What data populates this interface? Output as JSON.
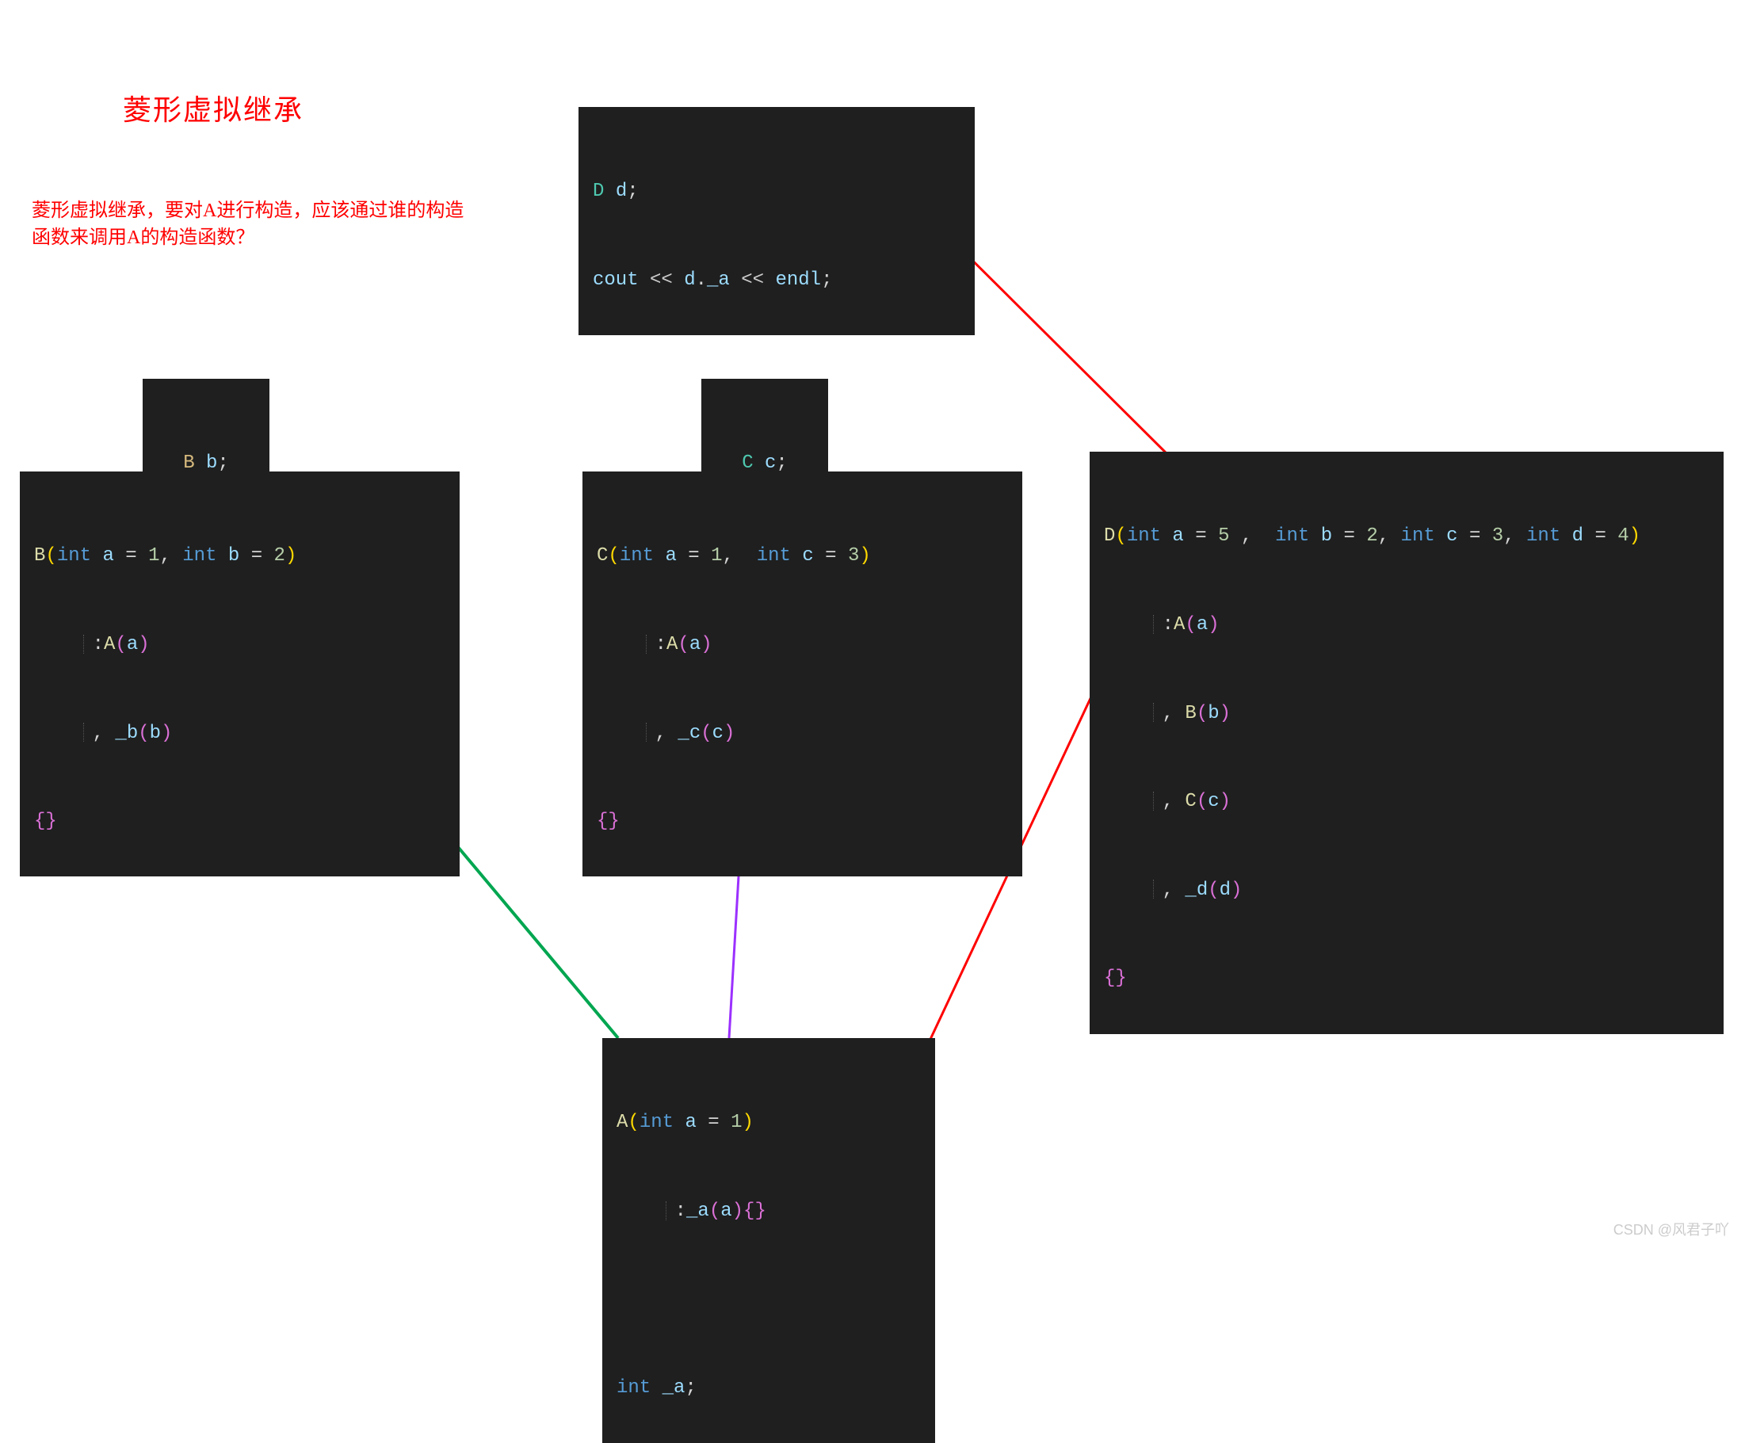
{
  "title": "菱形虚拟继承",
  "subtitle_l1": "菱形虚拟继承，要对A进行构造，应该通过谁的构造",
  "subtitle_l2": "函数来调用A的构造函数？",
  "watermark": "CSDN @风君子吖",
  "box_top": {
    "l1": {
      "D": "D",
      "sp": " ",
      "d": "d",
      "semi": ";"
    },
    "l2": {
      "cout": "cout",
      "op1": " << ",
      "d": "d",
      "dot": ".",
      "a": "_a",
      "op2": " << ",
      "endl": "endl",
      "semi": ";"
    }
  },
  "box_bb": {
    "B": "B ",
    "b": "b",
    "semi": ";"
  },
  "box_cc": {
    "C": "C ",
    "c": "c",
    "semi": ";"
  },
  "box_B": {
    "l1": {
      "B": "B",
      "lp": "(",
      "int1": "int",
      "sp1": " ",
      "a": "a",
      "eq1": " = ",
      "one": "1",
      "comma": ", ",
      "int2": "int",
      "sp2": " ",
      "b": "b",
      "eq2": " = ",
      "two": "2",
      "rp": ")"
    },
    "l2": {
      "colon": ":",
      "A": "A",
      "lp": "(",
      "a": "a",
      "rp": ")"
    },
    "l3": {
      "comma": ", ",
      "_b": "_b",
      "lp": "(",
      "b": "b",
      "rp": ")"
    },
    "l4": {
      "lb": "{",
      "rb": "}"
    }
  },
  "box_C": {
    "l1": {
      "C": "C",
      "lp": "(",
      "int1": "int",
      "sp1": " ",
      "a": "a",
      "eq1": " = ",
      "one": "1",
      "comma": ",  ",
      "int2": "int",
      "sp2": " ",
      "c": "c",
      "eq2": " = ",
      "three": "3",
      "rp": ")"
    },
    "l2": {
      "colon": ":",
      "A": "A",
      "lp": "(",
      "a": "a",
      "rp": ")"
    },
    "l3": {
      "comma": ", ",
      "_c": "_c",
      "lp": "(",
      "c": "c",
      "rp": ")"
    },
    "l4": {
      "lb": "{",
      "rb": "}"
    }
  },
  "box_D": {
    "l1": {
      "D": "D",
      "lp": "(",
      "int1": "int",
      "a": " a",
      "eq1": " = ",
      "five": "5",
      "c1": " ,  ",
      "int2": "int",
      "b": " b",
      "eq2": " = ",
      "two": "2",
      "c2": ", ",
      "int3": "int",
      "cvar": " c",
      "eq3": " = ",
      "three": "3",
      "c3": ", ",
      "int4": "int",
      "dvar": " d",
      "eq4": " = ",
      "four": "4",
      "rp": ")"
    },
    "l2": {
      "colon": ":",
      "A": "A",
      "lp": "(",
      "a": "a",
      "rp": ")"
    },
    "l3": {
      "comma": ", ",
      "B": "B",
      "lp": "(",
      "b": "b",
      "rp": ")"
    },
    "l4": {
      "comma": ", ",
      "C": "C",
      "lp": "(",
      "c": "c",
      "rp": ")"
    },
    "l5": {
      "comma": ", ",
      "_d": "_d",
      "lp": "(",
      "d": "d",
      "rp": ")"
    },
    "l6": {
      "lb": "{",
      "rb": "}"
    }
  },
  "box_A": {
    "l1": {
      "A": "A",
      "lp": "(",
      "int": "int",
      "sp": " ",
      "a": "a",
      "eq": " = ",
      "one": "1",
      "rp": ")"
    },
    "l2": {
      "colon": ":",
      "_a": "_a",
      "lp": "(",
      "a": "a",
      "rp": ")",
      "lb": "{",
      "rb": "}"
    },
    "l3": {
      "blank": " "
    },
    "l4": {
      "int": "int",
      "sp": " ",
      "_a": "_a",
      "semi": ";"
    }
  }
}
